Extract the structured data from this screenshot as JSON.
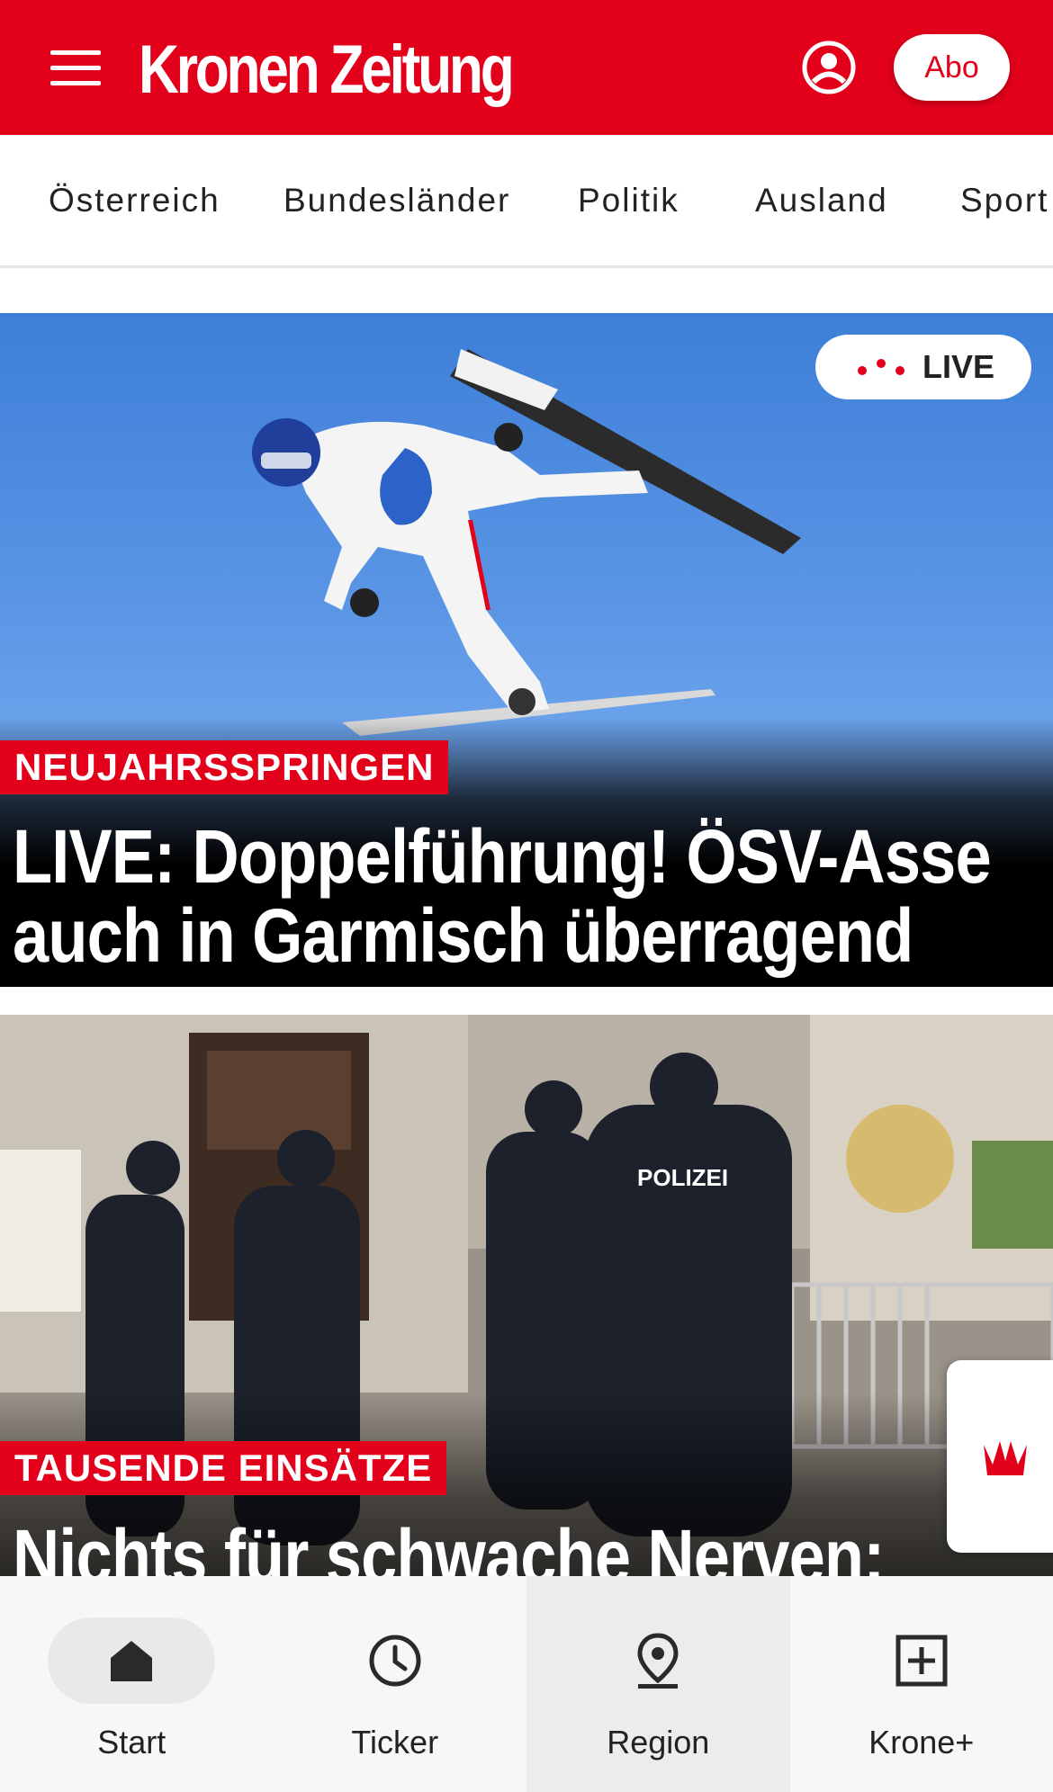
{
  "colors": {
    "brand": "#e2001a",
    "header_text": "#ffffff",
    "nav_background": "#f7f7f7"
  },
  "header": {
    "logo": "Kronen Zeitung",
    "menu_icon": "hamburger-menu-icon",
    "user_icon": "user-account-icon",
    "abo_label": "Abo"
  },
  "sections": [
    "Österreich",
    "Bundesländer",
    "Politik",
    "Ausland",
    "Sport"
  ],
  "articles": [
    {
      "live_label": "LIVE",
      "kicker": "NEUJAHRSSPRINGEN",
      "headline_line1": "LIVE: Doppelführung! ÖSV-Asse",
      "headline_line2": "auch in Garmisch überragend"
    },
    {
      "kicker": "TAUSENDE EINSÄTZE",
      "headline_line1": "Nichts für schwache Nerven:"
    }
  ],
  "floating_button": {
    "icon": "krone-crown-icon"
  },
  "bottom_nav": [
    {
      "label": "Start",
      "icon": "home-icon",
      "active": true
    },
    {
      "label": "Ticker",
      "icon": "clock-icon",
      "active": false
    },
    {
      "label": "Region",
      "icon": "location-pin-icon",
      "active": false
    },
    {
      "label": "Krone+",
      "icon": "plus-box-icon",
      "active": false
    }
  ]
}
